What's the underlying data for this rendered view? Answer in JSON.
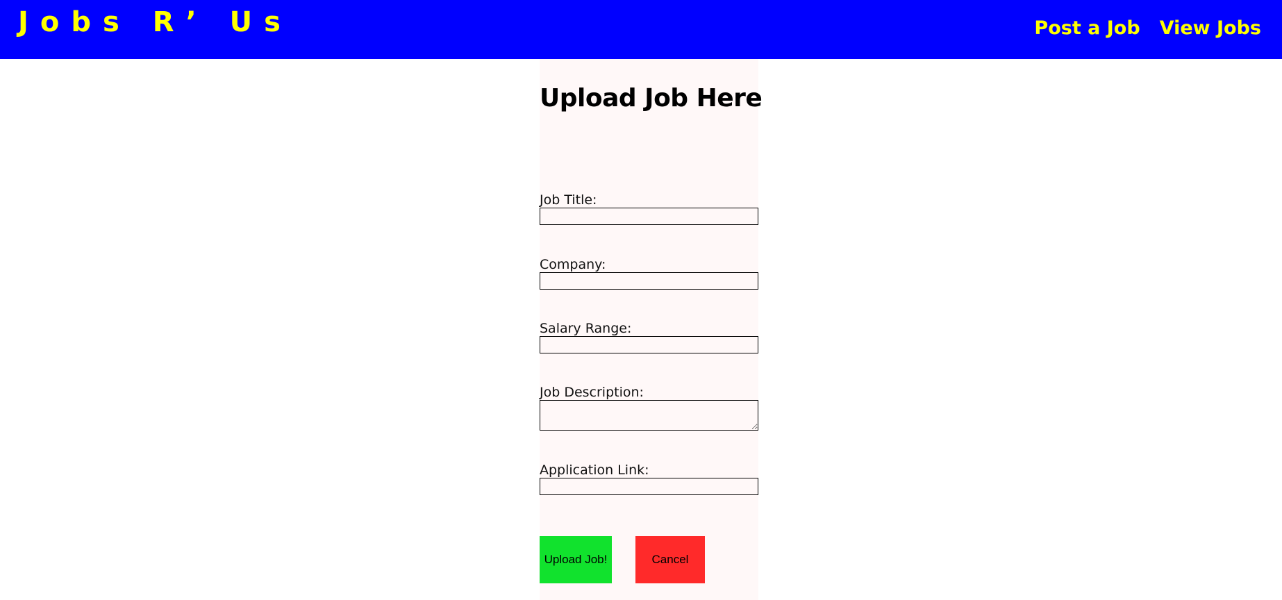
{
  "header": {
    "brand": "Jobs R’ Us",
    "nav": [
      {
        "label": "Post a Job"
      },
      {
        "label": "View Jobs"
      }
    ]
  },
  "form": {
    "title": "Upload Job Here",
    "fields": [
      {
        "label": "Job Title:",
        "value": ""
      },
      {
        "label": "Company:",
        "value": ""
      },
      {
        "label": "Salary Range:",
        "value": ""
      },
      {
        "label": "Job Description:",
        "value": ""
      },
      {
        "label": "Application Link:",
        "value": ""
      }
    ],
    "submit_label": "Upload Job!",
    "cancel_label": "Cancel"
  },
  "colors": {
    "header_bg": "#0000ff",
    "header_text": "#ffff00",
    "panel_bg": "#fff8f8",
    "submit_bg": "#11e22d",
    "cancel_bg": "#ff2a2a"
  }
}
